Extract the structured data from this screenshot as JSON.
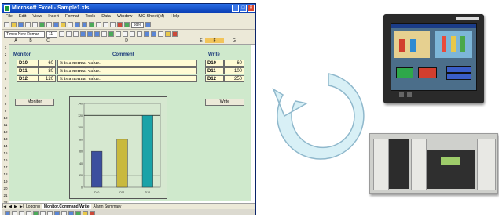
{
  "window": {
    "title": "Microsoft Excel - Sample1.xls",
    "min": "_",
    "max": "□",
    "close": "×"
  },
  "menu": [
    "File",
    "Edit",
    "View",
    "Insert",
    "Format",
    "Tools",
    "Data",
    "Window",
    "MC Sheet(M)",
    "Help"
  ],
  "toolbar": {
    "font": "Times New Roman",
    "size": "11",
    "zoom": "99%"
  },
  "columns": [
    "A",
    "B",
    "C",
    "D",
    "E",
    "F",
    "G"
  ],
  "rows": [
    "1",
    "2",
    "3",
    "4",
    "5",
    "6",
    "7",
    "8",
    "9",
    "10",
    "11",
    "12",
    "13",
    "14",
    "15",
    "16",
    "17",
    "18",
    "19",
    "20",
    "21",
    "22"
  ],
  "headers": {
    "monitor": "Monitor",
    "comment": "Comment",
    "write": "Write"
  },
  "monitor_rows": [
    {
      "device": "D10",
      "value": "60"
    },
    {
      "device": "D11",
      "value": "80"
    },
    {
      "device": "D12",
      "value": "120"
    }
  ],
  "comments": [
    "It is a normal value.",
    "It is a normal value.",
    "It is a normal value."
  ],
  "write_rows": [
    {
      "device": "D10",
      "value": "60"
    },
    {
      "device": "D11",
      "value": "100"
    },
    {
      "device": "D12",
      "value": "250"
    }
  ],
  "buttons": {
    "monitor": "Monitor",
    "write": "Write"
  },
  "chart_data": {
    "type": "bar",
    "categories": [
      "D10",
      "D11",
      "D12"
    ],
    "values": [
      60,
      80,
      120
    ],
    "ylim": [
      0,
      140
    ],
    "yticks": [
      "0",
      "20",
      "40",
      "60",
      "80",
      "100",
      "120",
      "140"
    ],
    "reference_lines": [
      20,
      120
    ],
    "bar_colors": [
      "#3c4f9e",
      "#c9b93e",
      "#1aa3a8"
    ],
    "grid": false
  },
  "sheet_tabs": [
    "Logging",
    "Monitor,Command,Write",
    "Alarm Summary"
  ],
  "colors": {
    "sheet_bg": "#cfe9cc",
    "cell_bg": "#fffbd4",
    "title_bar": "#0a3fb5",
    "arrow": "#d8f0f6",
    "arrow_stroke": "#8fb8cc"
  }
}
